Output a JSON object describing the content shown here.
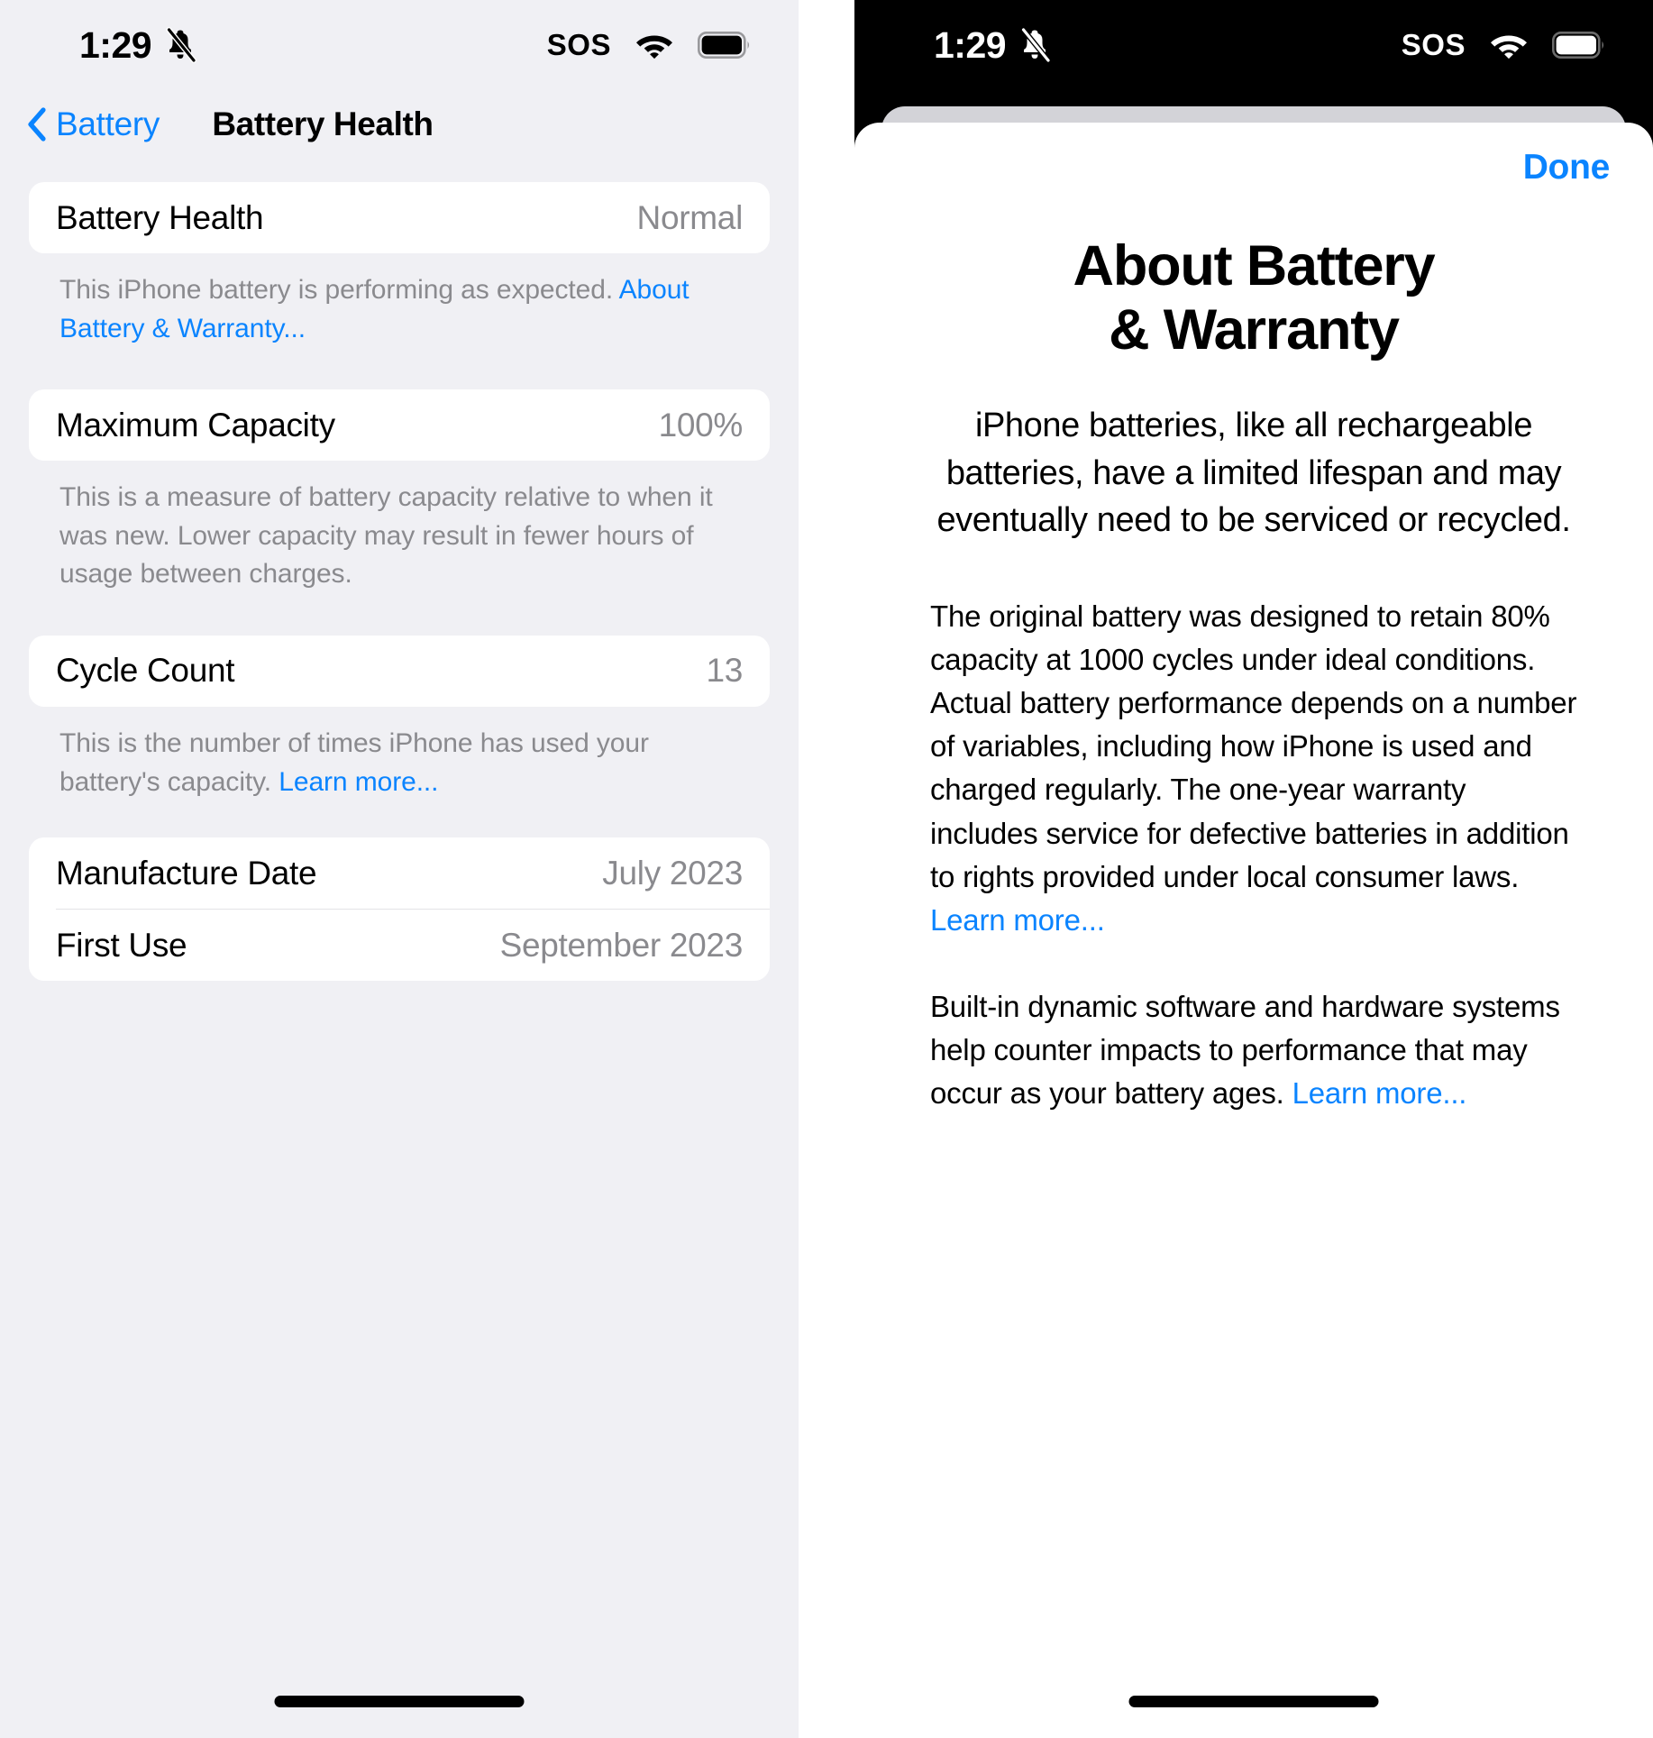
{
  "status_bar": {
    "time": "1:29",
    "sos_label": "SOS",
    "silent_icon": "bell-slash-icon",
    "wifi_icon": "wifi-icon",
    "battery_icon": "battery-full-icon"
  },
  "left_screen": {
    "nav": {
      "back_label": "Battery",
      "back_icon": "chevron-left-icon",
      "title": "Battery Health"
    },
    "sections": [
      {
        "rows": [
          {
            "label": "Battery Health",
            "value": "Normal"
          }
        ],
        "footnote_text": "This iPhone battery is performing as expected. ",
        "footnote_link": "About Battery & Warranty..."
      },
      {
        "rows": [
          {
            "label": "Maximum Capacity",
            "value": "100%"
          }
        ],
        "footnote_text": "This is a measure of battery capacity relative to when it was new. Lower capacity may result in fewer hours of usage between charges.",
        "footnote_link": ""
      },
      {
        "rows": [
          {
            "label": "Cycle Count",
            "value": "13"
          }
        ],
        "footnote_text": "This is the number of times iPhone has used your battery's capacity. ",
        "footnote_link": "Learn more..."
      },
      {
        "rows": [
          {
            "label": "Manufacture Date",
            "value": "July 2023"
          },
          {
            "label": "First Use",
            "value": "September 2023"
          }
        ],
        "footnote_text": "",
        "footnote_link": ""
      }
    ]
  },
  "right_screen": {
    "done_label": "Done",
    "title_line1": "About Battery",
    "title_line2": "& Warranty",
    "intro": "iPhone batteries, like all rechargeable batteries, have a limited lifespan and may eventually need to be serviced or recycled.",
    "paragraph1_text": "The original battery was designed to retain 80% capacity at 1000 cycles under ideal conditions. Actual battery performance depends on a number of variables, including how iPhone is used and charged regularly. The one-year warranty includes service for defective batteries in addition to rights provided under local consumer laws. ",
    "paragraph1_link": "Learn more...",
    "paragraph2_text": "Built-in dynamic software and hardware systems help counter impacts to performance that may occur as your battery ages. ",
    "paragraph2_link": "Learn more..."
  },
  "colors": {
    "accent_blue": "#0a84ff",
    "secondary_text": "#8a8a8e",
    "left_background": "#f0f0f4",
    "sheet_background": "#ffffff"
  }
}
